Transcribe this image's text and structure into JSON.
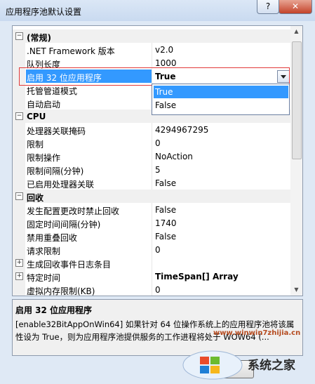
{
  "window": {
    "title": "应用程序池默认设置",
    "help_label": "?",
    "close_label": "✕"
  },
  "rows": [
    {
      "type": "category",
      "name": "(常规)",
      "toggle": "−"
    },
    {
      "type": "prop",
      "name": ".NET Framework 版本",
      "value": "v2.0"
    },
    {
      "type": "prop",
      "name": "队列长度",
      "value": "1000"
    },
    {
      "type": "selected",
      "name": "启用 32 位应用程序",
      "value": "True"
    },
    {
      "type": "prop",
      "name": "托管管道模式",
      "value": ""
    },
    {
      "type": "prop",
      "name": "自动启动",
      "value": ""
    },
    {
      "type": "category",
      "name": "CPU",
      "toggle": "−"
    },
    {
      "type": "prop",
      "name": "处理器关联掩码",
      "value": "4294967295"
    },
    {
      "type": "prop",
      "name": "限制",
      "value": "0"
    },
    {
      "type": "prop",
      "name": "限制操作",
      "value": "NoAction"
    },
    {
      "type": "prop",
      "name": "限制间隔(分钟)",
      "value": "5"
    },
    {
      "type": "prop",
      "name": "已启用处理器关联",
      "value": "False"
    },
    {
      "type": "category",
      "name": "回收",
      "toggle": "−"
    },
    {
      "type": "prop",
      "name": "发生配置更改时禁止回收",
      "value": "False"
    },
    {
      "type": "prop",
      "name": "固定时间间隔(分钟)",
      "value": "1740"
    },
    {
      "type": "prop",
      "name": "禁用重叠回收",
      "value": "False"
    },
    {
      "type": "prop",
      "name": "请求限制",
      "value": "0"
    },
    {
      "type": "expand",
      "name": "生成回收事件日志条目",
      "value": "",
      "toggle": "+"
    },
    {
      "type": "expand",
      "name": "特定时间",
      "value": "TimeSpan[] Array",
      "toggle": "+",
      "bold_value": true
    },
    {
      "type": "prop",
      "name": "虚拟内存限制(KB)",
      "value": "0"
    }
  ],
  "dropdown": {
    "options": [
      "True",
      "False"
    ],
    "highlighted": "True"
  },
  "description": {
    "heading": "启用 32 位应用程序",
    "body": "[enable32BitAppOnWin64] 如果针对 64 位操作系统上的应用程序池将该属性设为 True，则为应用程序池提供服务的工作进程将处于 WOW64 (..."
  },
  "watermark": {
    "brand": "系统之家",
    "url": "www.winwin7zhijia.cn"
  }
}
